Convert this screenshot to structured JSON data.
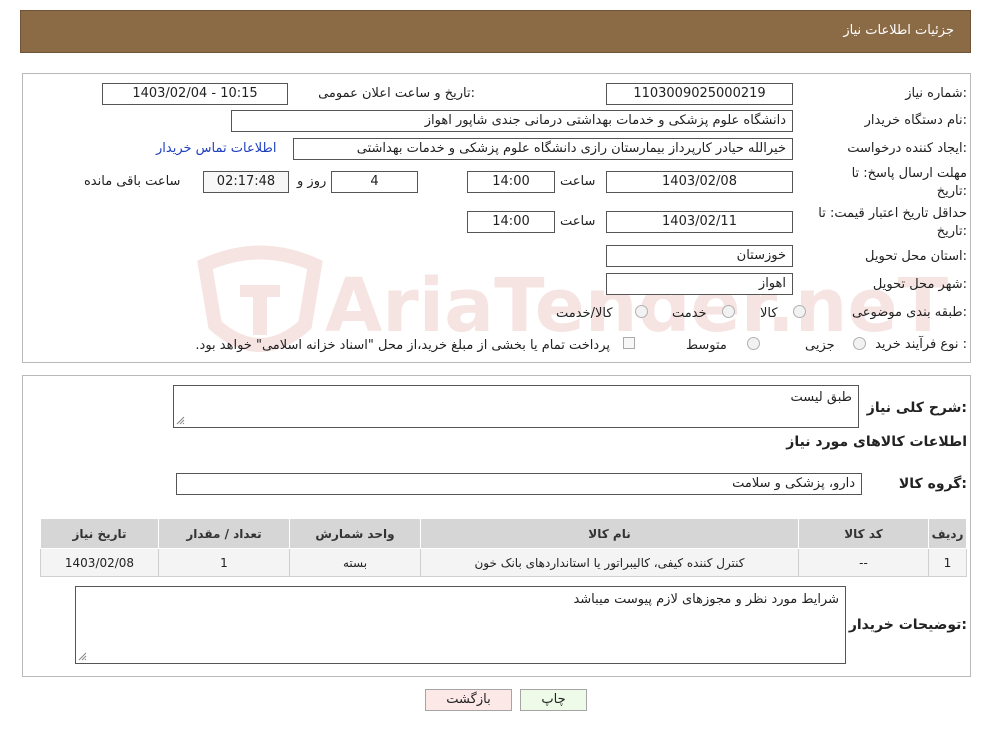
{
  "header": {
    "title": "جزئیات اطلاعات نیاز"
  },
  "form": {
    "need_number_label": "شماره نیاز:",
    "need_number": "1103009025000219",
    "announce_label": "تاریخ و ساعت اعلان عمومی:",
    "announce_value": "1403/02/04 - 10:15",
    "buyer_org_label": "نام دستگاه خریدار:",
    "buyer_org": "دانشگاه علوم پزشکی و خدمات بهداشتی درمانی جندی شاپور اهواز",
    "creator_label": "ایجاد کننده درخواست:",
    "creator": "خیرالله حیادر کارپرداز بیمارستان رازی  دانشگاه علوم پزشکی و خدمات بهداشتی",
    "contact_link": "اطلاعات تماس خریدار",
    "deadline_label_1": "مهلت ارسال پاسخ: تا",
    "deadline_label_2": "تاریخ:",
    "deadline_date": "1403/02/08",
    "time_label": "ساعت",
    "deadline_time": "14:00",
    "days_value": "4",
    "days_label": "روز و",
    "remaining_time": "02:17:48",
    "remaining_label": "ساعت باقی مانده",
    "price_validity_label_1": "حداقل تاریخ اعتبار قیمت: تا",
    "price_validity_label_2": "تاریخ:",
    "price_validity_date": "1403/02/11",
    "price_validity_time": "14:00",
    "province_label": "استان محل تحویل:",
    "province": "خوزستان",
    "city_label": "شهر محل تحویل:",
    "city": "اهواز",
    "category_label": "طبقه بندی موضوعی:",
    "category_options": [
      "کالا",
      "خدمت",
      "کالا/خدمت"
    ],
    "process_label": "نوع فرآیند خرید :",
    "process_options": [
      "جزیی",
      "متوسط"
    ],
    "payment_note": "پرداخت تمام یا بخشی از مبلغ خرید،از محل \"اسناد خزانه اسلامی\" خواهد بود."
  },
  "details": {
    "summary_label": "شرح کلی نیاز:",
    "summary_value": "طبق لیست",
    "items_heading": "اطلاعات کالاهای مورد نیاز",
    "goods_group_label": "گروه کالا:",
    "goods_group_value": "دارو، پزشکی و سلامت",
    "table_headers": [
      "ردیف",
      "کد کالا",
      "نام کالا",
      "واحد شمارش",
      "تعداد / مقدار",
      "تاریخ نیاز"
    ],
    "rows": [
      [
        "1",
        "--",
        "کنترل کننده کیفی، کالیبراتور یا استانداردهای بانک خون",
        "بسته",
        "1",
        "1403/02/08"
      ]
    ],
    "buyer_notes_label": "توضیحات خریدار:",
    "buyer_notes_value": "شرایط مورد نظر و مجوزهای لازم پیوست میباشد"
  },
  "buttons": {
    "print": "چاپ",
    "back": "بازگشت"
  },
  "watermark_text": "AriaTender.neT",
  "colors": {
    "header_bg": "#8b6a46",
    "back_button_bg": "#fde8e8",
    "print_button_bg": "#eefbe8",
    "link": "#1f3fbf"
  }
}
